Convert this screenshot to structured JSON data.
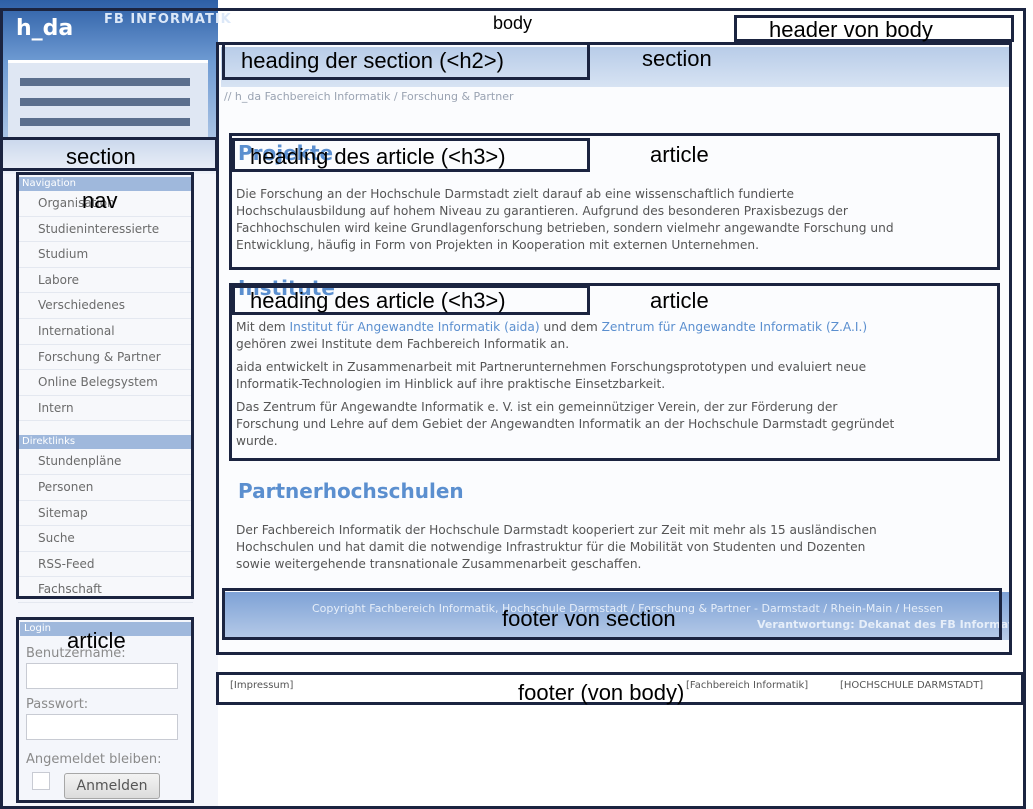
{
  "site": {
    "logo": "h_da",
    "department": "FB INFORMATIK"
  },
  "overlay_labels": {
    "body": "body",
    "header_body": "header von body",
    "section_heading": "heading der section (<h2>)",
    "section": "section",
    "left_section": "section",
    "nav": "nav",
    "article_heading_1": "heading des article (<h3>)",
    "article_1": "article",
    "article_heading_2": "heading des article (<h3>)",
    "article_2": "article",
    "left_article": "article",
    "footer_section": "footer von section",
    "footer_body": "footer (von body)"
  },
  "breadcrumb": "// h_da Fachbereich Informatik / Forschung & Partner",
  "navigation": {
    "heading": "Navigation",
    "items": [
      "Organisation",
      "Studieninteressierte",
      "Studium",
      "Labore",
      "Verschiedenes",
      "International",
      "Forschung & Partner",
      "Online Belegsystem",
      "Intern"
    ]
  },
  "direktlinks": {
    "heading": "Direktlinks",
    "items": [
      "Stundenpläne",
      "Personen",
      "Sitemap",
      "Suche",
      "RSS-Feed",
      "Fachschaft"
    ]
  },
  "login": {
    "heading": "Login",
    "username_label": "Benutzername:",
    "password_label": "Passwort:",
    "remember_label": "Angemeldet bleiben:",
    "submit_label": "Anmelden"
  },
  "articles": {
    "projekte_heading": "Projekte",
    "projekte_text": [
      "Die Forschung an der Hochschule Darmstadt zielt darauf ab eine wissenschaftlich fundierte",
      "Hochschulausbildung auf hohem Niveau zu garantieren. Aufgrund des besonderen Praxisbezugs der",
      "Fachhochschulen wird keine Grundlagenforschung betrieben, sondern vielmehr angewandte Forschung und",
      "Entwicklung, häufig in Form von Projekten in Kooperation mit externen Unternehmen."
    ],
    "institute_heading": "Institute",
    "institute_p1_before": "Mit dem",
    "institute_link1": "Institut für Angewandte Informatik (aida)",
    "institute_p1_middle": "und dem",
    "institute_link2": "Zentrum für Angewandte Informatik (Z.A.I.)",
    "institute_p1_after": "gehören zwei Institute dem Fachbereich Informatik an.",
    "institute_p2": [
      "aida entwickelt in Zusammenarbeit mit Partnerunternehmen Forschungsprototypen und evaluiert neue",
      "Informatik-Technologien im Hinblick auf ihre praktische Einsetzbarkeit."
    ],
    "institute_p3": [
      "Das Zentrum für Angewandte Informatik e. V. ist ein gemeinnütziger Verein, der zur Förderung der",
      "Forschung und Lehre auf dem Gebiet der Angewandten Informatik an der Hochschule Darmstadt gegründet",
      "wurde."
    ],
    "partner_heading": "Partnerhochschulen",
    "partner_text": [
      "Der Fachbereich Informatik der Hochschule Darmstadt kooperiert zur Zeit mit mehr als 15 ausländischen",
      "Hochschulen und hat damit die notwendige Infrastruktur für die Mobilität von Studenten und Dozenten",
      "sowie weitergehende transnationale Zusammenarbeit geschaffen."
    ]
  },
  "section_footer": {
    "copyright_line": "Copyright Fachbereich Informatik, Hochschule Darmstadt / Forschung & Partner - Darmstadt / Rhein-Main / Hessen",
    "responsibility_line": "Verantwortung: Dekanat des FB Informatik"
  },
  "body_footer": {
    "impressum": "[Impressum]",
    "fb_link": "[Fachbereich Informatik]",
    "hs_link": "[HOCHSCHULE DARMSTADT]"
  }
}
